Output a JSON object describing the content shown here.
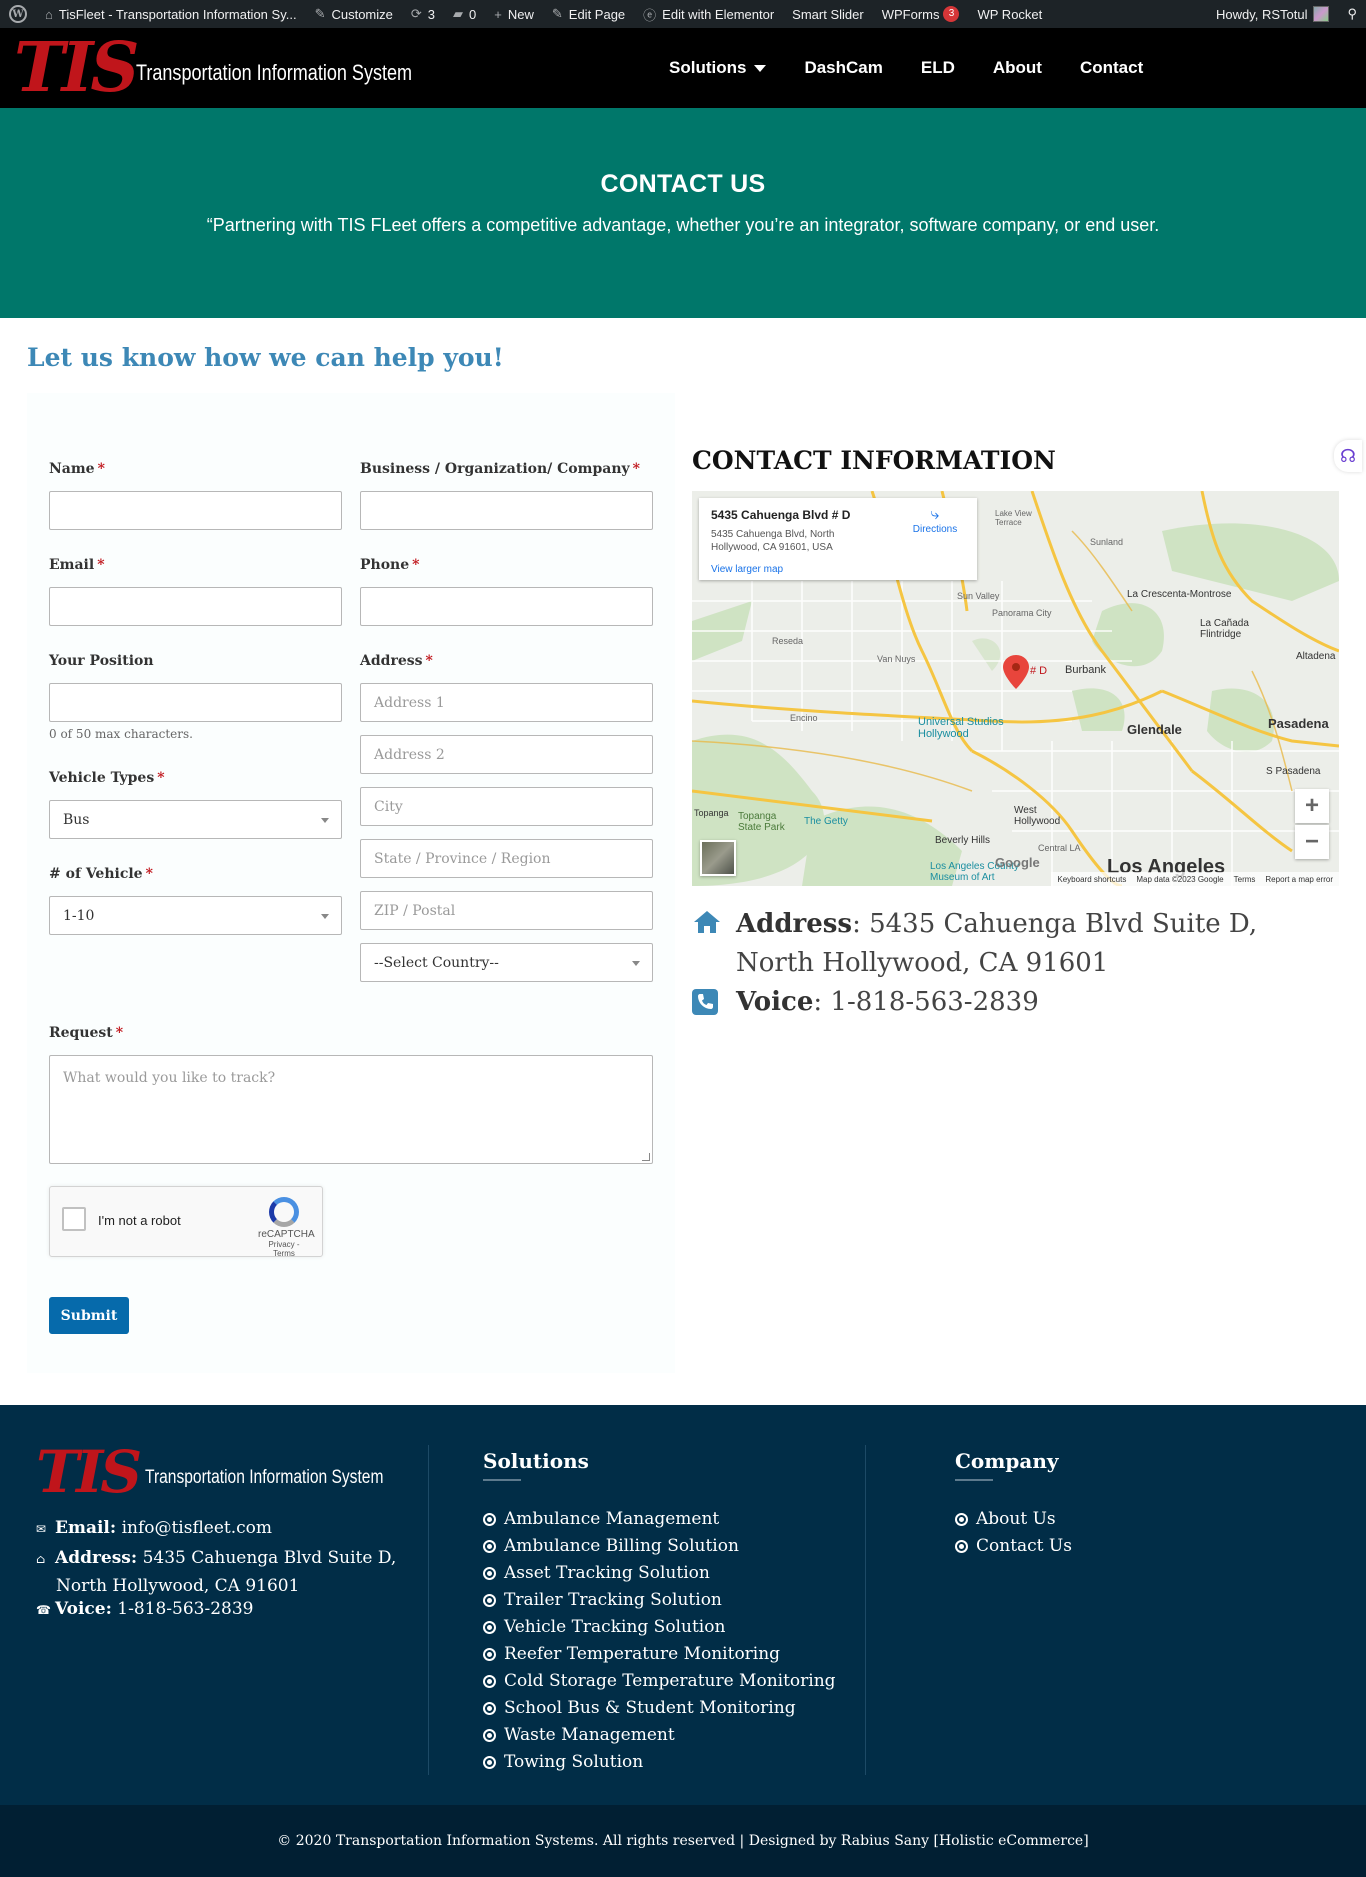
{
  "admin_bar": {
    "site_title": "TisFleet - Transportation Information Sy...",
    "customize": "Customize",
    "updates_count": "3",
    "comments_count": "0",
    "new": "New",
    "edit_page": "Edit Page",
    "edit_elementor": "Edit with Elementor",
    "smart_slider": "Smart Slider",
    "wpforms": "WPForms",
    "wpforms_badge": "3",
    "wp_rocket": "WP Rocket",
    "howdy": "Howdy, RSTotul"
  },
  "header": {
    "logo_text": "TIS",
    "logo_subtitle": "Transportation Information System",
    "nav": [
      "Solutions",
      "DashCam",
      "ELD",
      "About",
      "Contact"
    ]
  },
  "hero": {
    "title": "CONTACT US",
    "subtitle": "“Partnering with TIS FLeet offers a competitive advantage, whether you’re an integrator, software company, or end user."
  },
  "form": {
    "heading": "Let us know how we can help you!",
    "required_mark": "*",
    "name_label": "Name",
    "business_label": "Business / Organization/ Company",
    "email_label": "Email",
    "phone_label": "Phone",
    "position_label": "Your Position",
    "position_hint": "0 of 50 max characters.",
    "address_label": "Address",
    "address1_placeholder": "Address 1",
    "address2_placeholder": "Address 2",
    "city_placeholder": "City",
    "state_placeholder": "State / Province / Region",
    "zip_placeholder": "ZIP / Postal",
    "country_value": "--Select Country--",
    "vehicle_types_label": "Vehicle Types",
    "vehicle_types_value": "Bus",
    "num_vehicle_label": "# of Vehicle",
    "num_vehicle_value": "1-10",
    "request_label": "Request",
    "request_placeholder": "What would you like to track?",
    "captcha_text": "I'm not a robot",
    "captcha_brand": "reCAPTCHA",
    "captcha_terms": "Privacy - Terms",
    "submit_label": "Submit"
  },
  "contact_info": {
    "title": "CONTACT INFORMATION",
    "map": {
      "card_title": "5435 Cahuenga Blvd # D",
      "card_address": "5435 Cahuenga Blvd, North Hollywood, CA 91601, USA",
      "directions": "Directions",
      "larger_map": "View larger map",
      "pin_label": "# D",
      "labels": [
        "Burbank",
        "Glendale",
        "Pasadena",
        "Universal Studios Hollywood",
        "La Crescenta-Montrose",
        "La Cañada Flintridge",
        "Sunland",
        "Lake View Terrace",
        "Panorama City",
        "Sun Valley",
        "Reseda",
        "Van Nuys",
        "Encino",
        "Topanga State Park",
        "The Getty",
        "Beverly Hills",
        "West Hollywood",
        "Los Angeles",
        "Altadena",
        "S Pasadena",
        "Central LA",
        "Los Angeles County Museum of Art",
        "Topanga"
      ],
      "footer": [
        "Keyboard shortcuts",
        "Map data ©2023 Google",
        "Terms",
        "Report a map error"
      ],
      "google": "Google"
    },
    "address_label": "Address",
    "address_line1": ": 5435 Cahuenga Blvd Suite D,",
    "address_line2": "North Hollywood, CA 91601",
    "voice_label": "Voice",
    "voice_value": ": 1-818-563-2839"
  },
  "footer": {
    "logo_text": "TIS",
    "logo_subtitle": "Transportation Information System",
    "email_label": "Email:",
    "email_value": "info@tisfleet.com",
    "address_label": "Address:",
    "address_line1": "5435 Cahuenga Blvd Suite D,",
    "address_line2": "North Hollywood, CA 91601",
    "voice_label": "Voice:",
    "voice_value": "1-818-563-2839",
    "solutions_title": "Solutions",
    "solutions": [
      "Ambulance Management",
      "Ambulance Billing Solution",
      "Asset Tracking Solution",
      "Trailer Tracking Solution",
      "Vehicle Tracking Solution",
      "Reefer Temperature Monitoring",
      "Cold Storage Temperature Monitoring",
      "School Bus & Student Monitoring",
      "Waste Management",
      "Towing Solution"
    ],
    "company_title": "Company",
    "company": [
      "About Us",
      "Contact Us"
    ],
    "copyright": "© 2020 Transportation Information Systems. All rights reserved | Designed by Rabius Sany [Holistic eCommerce]"
  },
  "colors": {
    "brand_red": "#c0151b",
    "hero_teal": "#00776a",
    "heading_blue": "#3d88b6",
    "submit_blue": "#066aab",
    "footer_navy": "#012d47"
  }
}
